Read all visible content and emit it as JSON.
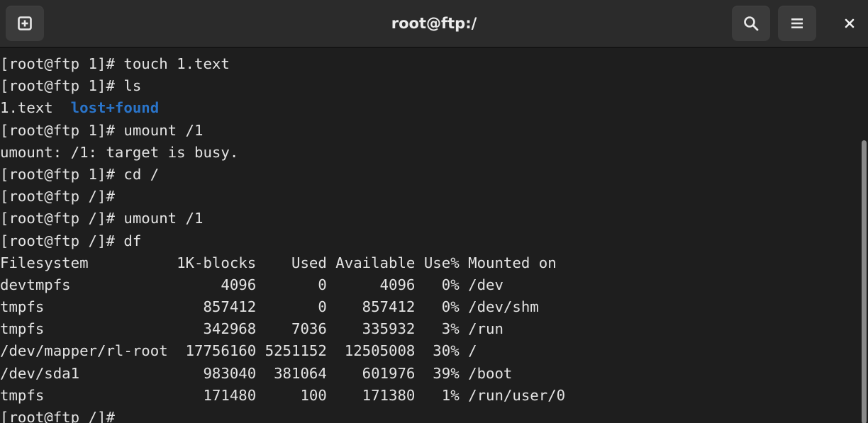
{
  "window": {
    "title": "root@ftp:/"
  },
  "icons": {
    "new_tab": "new-tab-icon",
    "search": "search-icon",
    "menu": "hamburger-menu-icon",
    "close": "close-icon"
  },
  "colors": {
    "background": "#1e1e1e",
    "headerbar": "#2b2b2b",
    "text": "#e3e3e3",
    "directory": "#2a74c9"
  },
  "terminal": {
    "lines": [
      "[root@ftp 1]# touch 1.text",
      "[root@ftp 1]# ls",
      "1.text  ",
      "[root@ftp 1]# umount /1",
      "umount: /1: target is busy.",
      "[root@ftp 1]# cd /",
      "[root@ftp /]#",
      "[root@ftp /]# umount /1",
      "[root@ftp /]# df",
      "Filesystem          1K-blocks    Used Available Use% Mounted on",
      "devtmpfs                 4096       0      4096   0% /dev",
      "tmpfs                  857412       0    857412   0% /dev/shm",
      "tmpfs                  342968    7036    335932   3% /run",
      "/dev/mapper/rl-root  17756160 5251152  12505008  30% /",
      "/dev/sda1              983040  381064    601976  39% /boot",
      "tmpfs                  171480     100    171380   1% /run/user/0",
      "[root@ftp /]#"
    ],
    "ls_directory": "lost+found"
  }
}
